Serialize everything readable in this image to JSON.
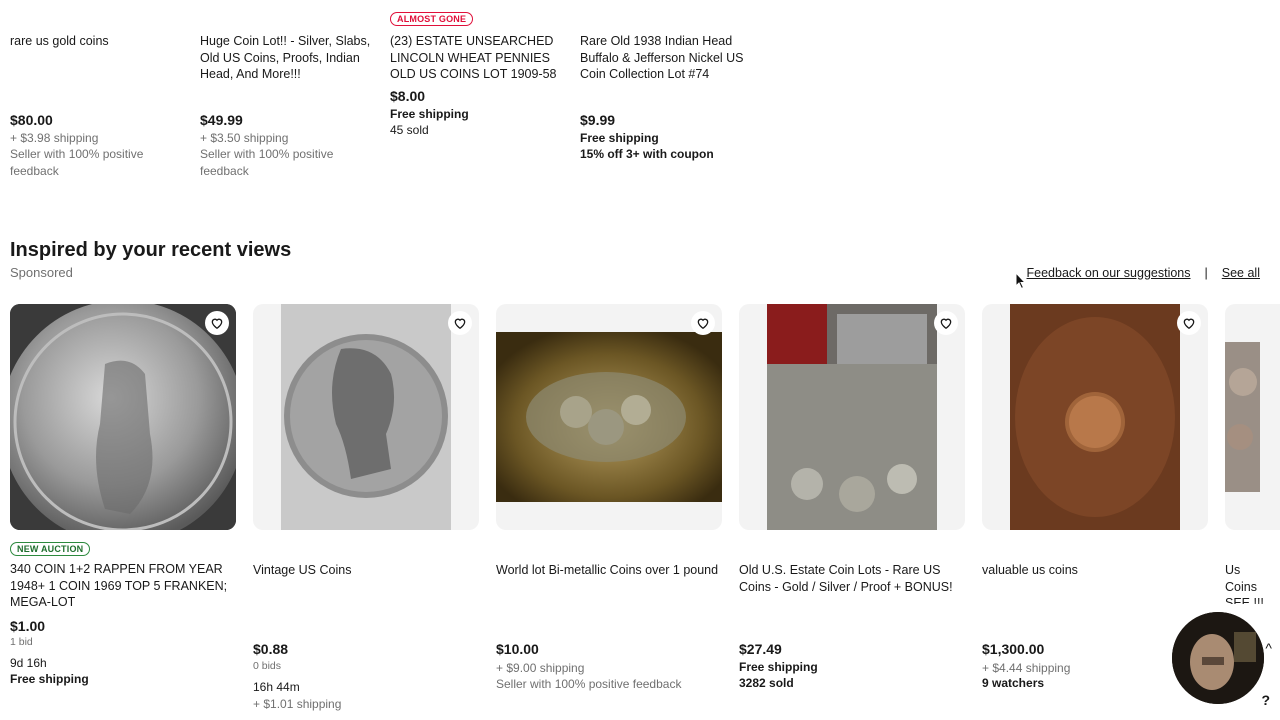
{
  "top_items": [
    {
      "title": "rare us gold coins",
      "price": "$80.00",
      "shipping": "+ $3.98 shipping",
      "note": "Seller with 100% positive feedback"
    },
    {
      "title": "Huge Coin Lot!! - Silver, Slabs, Old US Coins, Proofs, Indian Head, And More!!!",
      "price": "$49.99",
      "shipping": "+ $3.50 shipping",
      "note": "Seller with 100% positive feedback"
    },
    {
      "badge": "ALMOST GONE",
      "title": "(23) ESTATE UNSEARCHED LINCOLN WHEAT PENNIES OLD US COINS LOT 1909-58",
      "price": "$8.00",
      "shipping": "Free shipping",
      "note": "45 sold"
    },
    {
      "title": "Rare Old 1938 Indian Head Buffalo & Jefferson Nickel US Coin Collection Lot #74",
      "price": "$9.99",
      "shipping": "Free shipping",
      "note": "15% off 3+ with coupon"
    }
  ],
  "section": {
    "title": "Inspired by your recent views",
    "sponsored": "Sponsored",
    "feedback_link": "Feedback on our suggestions",
    "separator": "|",
    "see_all": "See all"
  },
  "cards": [
    {
      "badge": "NEW AUCTION",
      "title": "340 COIN 1+2 RAPPEN FROM YEAR 1948+ 1 COIN 1969 TOP 5 FRANKEN; MEGA-LOT",
      "price": "$1.00",
      "bids": "1 bid",
      "time": "9d 16h",
      "shipping": "Free shipping"
    },
    {
      "title": "Vintage US Coins",
      "price": "$0.88",
      "bids": "0 bids",
      "time": "16h 44m",
      "shipping": "+ $1.01 shipping"
    },
    {
      "title": "World lot Bi-metallic Coins over 1 pound",
      "price": "$10.00",
      "shipping": "+ $9.00 shipping",
      "note": "Seller with 100% positive feedback"
    },
    {
      "title": "Old U.S. Estate Coin Lots - Rare US Coins - Gold / Silver / Proof + BONUS!",
      "price": "$27.49",
      "shipping": "Free shipping",
      "note": "3282 sold"
    },
    {
      "title": "valuable us coins",
      "price": "$1,300.00",
      "shipping": "+ $4.44 shipping",
      "note": "9 watchers"
    },
    {
      "title": "Us Coins SEE !!!"
    }
  ],
  "icons": {
    "heart": "heart-outline-icon",
    "help": "?",
    "chevron": "^"
  },
  "colors": {
    "badge_red": "#e0103a",
    "badge_green": "#2d8a3e",
    "text": "#191919",
    "muted": "#707070"
  }
}
